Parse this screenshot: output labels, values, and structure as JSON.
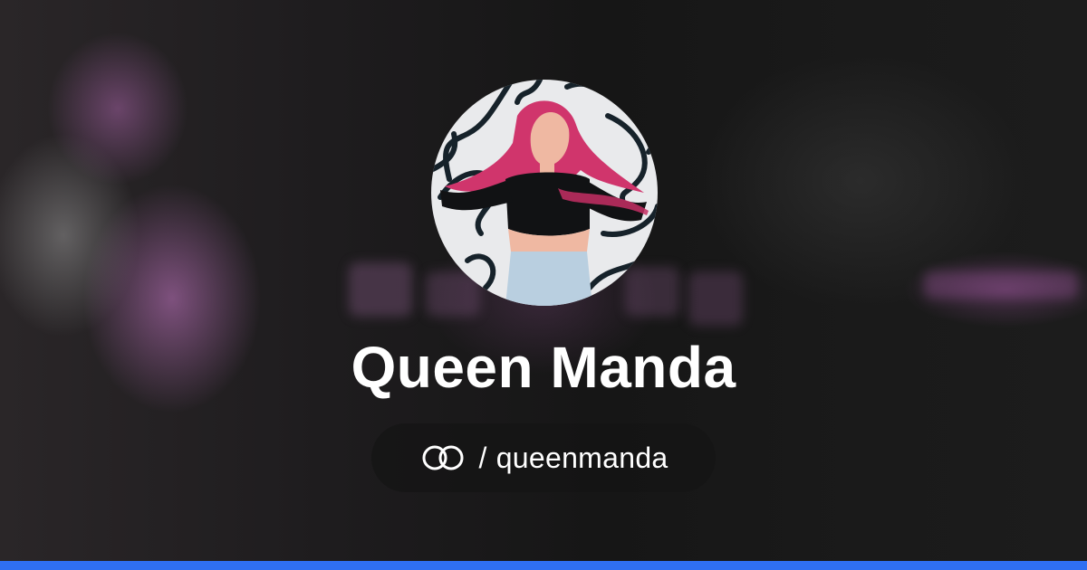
{
  "profile": {
    "display_name": "Queen Manda",
    "link_separator": "/",
    "username": "queenmanda",
    "avatar_alt": "Queen Manda"
  },
  "icons": {
    "logo": "linked-rings-icon"
  },
  "colors": {
    "accent_bar": "#2f6ff2",
    "text": "#ffffff",
    "pill_background": "#141414"
  }
}
